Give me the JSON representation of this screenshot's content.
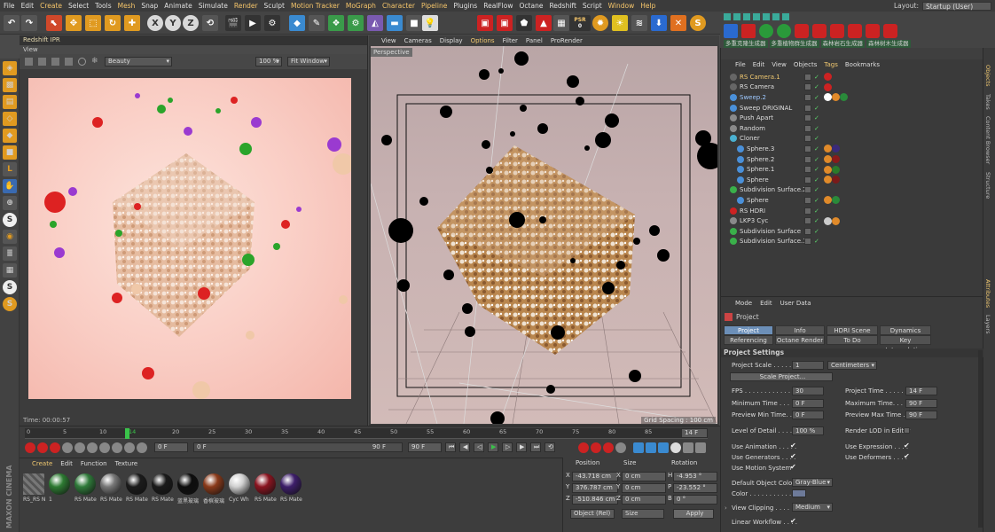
{
  "menu": {
    "items": [
      "File",
      "Edit",
      "Create",
      "Select",
      "Tools",
      "Mesh",
      "Snap",
      "Animate",
      "Simulate",
      "Render",
      "Sculpt",
      "Motion Tracker",
      "MoGraph",
      "Character",
      "Pipeline",
      "Plugins",
      "RealFlow",
      "Octane",
      "Redshift",
      "Script",
      "Window",
      "Help"
    ],
    "layout_label": "Layout:",
    "layout_value": "Startup (User)"
  },
  "toolbar": {
    "coord_x": "X",
    "coord_y": "Y",
    "coord_z": "Z",
    "psr_label": "PSR",
    "psr_value": "0"
  },
  "right_toolbar": {
    "plugin_buttons": [
      "多重克隆生成器",
      "多重植物群生成器",
      "森林岩石生成器",
      "森林树木生成器"
    ]
  },
  "ipr": {
    "title": "Redshift IPR",
    "view_label": "View",
    "aov": "Beauty",
    "zoom": "100 %",
    "fit": "Fit Window",
    "time": "Time: 00:00:57"
  },
  "viewport": {
    "menu": [
      "View",
      "Cameras",
      "Display",
      "Options",
      "Filter",
      "Panel",
      "ProRender"
    ],
    "camera": "Perspective",
    "grid_spacing": "Grid Spacing : 100 cm"
  },
  "timeline": {
    "ticks": [
      "0",
      "5",
      "10",
      "14",
      "20",
      "25",
      "30",
      "35",
      "40",
      "45",
      "50",
      "55",
      "60",
      "65",
      "70",
      "75",
      "80",
      "85",
      "90"
    ],
    "current_frame": "14 F",
    "current_frame_tick": "14",
    "start_field": "0 F",
    "start_field2": "0 F",
    "end_field": "90 F",
    "end_field2": "90 F"
  },
  "materials": {
    "menu": [
      "Create",
      "Edit",
      "Function",
      "Texture"
    ],
    "items": [
      {
        "label": "RS_RS N",
        "color": "#6a6a6a"
      },
      {
        "label": "1",
        "color": "#2d7a32"
      },
      {
        "label": "RS Mate",
        "color": "#2f7a3a"
      },
      {
        "label": "RS Mate",
        "color": "#777777"
      },
      {
        "label": "RS Mate",
        "color": "#1b1b1b"
      },
      {
        "label": "RS Mate",
        "color": "#1a1a1a"
      },
      {
        "label": "蓝黑玻璃",
        "color": "#0d0d0d"
      },
      {
        "label": "香槟玻璃",
        "color": "#8a3a1a"
      },
      {
        "label": "Cyc Wh",
        "color": "#d0d0d0"
      },
      {
        "label": "RS Mate",
        "color": "#8a1420"
      },
      {
        "label": "RS Mate",
        "color": "#3d1e6a"
      }
    ],
    "brand": "MAXON CINEMA 4D"
  },
  "coords": {
    "headers": [
      "Position",
      "Size",
      "Rotation"
    ],
    "rows": [
      {
        "axis": "X",
        "pos": "-43.718 cm",
        "size": "0 cm",
        "rot_axis": "H",
        "rot": "-4.953 °"
      },
      {
        "axis": "Y",
        "pos": "376.787 cm",
        "size": "0 cm",
        "rot_axis": "P",
        "rot": "-23.552 °"
      },
      {
        "axis": "Z",
        "pos": "-510.846 cm",
        "size": "0 cm",
        "rot_axis": "B",
        "rot": "0 °"
      }
    ],
    "mode": "Object (Rel)",
    "size_mode": "Size",
    "apply": "Apply"
  },
  "objects": {
    "menu": [
      "File",
      "Edit",
      "View",
      "Objects",
      "Tags",
      "Bookmarks"
    ],
    "rows": [
      {
        "name": "RS Camera.1",
        "indent": 0,
        "color": "#f0c870",
        "dot": "#666",
        "tags": [
          "#cc2222"
        ]
      },
      {
        "name": "RS Camera",
        "indent": 0,
        "color": "#ddd",
        "dot": "#666",
        "tags": [
          "#cc2222"
        ]
      },
      {
        "name": "Sweep.2",
        "indent": 0,
        "color": "#9ec9ff",
        "dot": "#4a90d9",
        "tags": [
          "#ffffff",
          "#e08a2a",
          "#2a8a3a"
        ]
      },
      {
        "name": "Sweep ORIGINAL",
        "indent": 0,
        "color": "#ddd",
        "dot": "#4a90d9",
        "tags": []
      },
      {
        "name": "Push Apart",
        "indent": 0,
        "color": "#ddd",
        "dot": "#8a8a8a",
        "tags": []
      },
      {
        "name": "Random",
        "indent": 0,
        "color": "#ddd",
        "dot": "#8a8a8a",
        "tags": []
      },
      {
        "name": "Cloner",
        "indent": 0,
        "color": "#ddd",
        "dot": "#4ab0d0",
        "tags": []
      },
      {
        "name": "Sphere.3",
        "indent": 1,
        "color": "#ddd",
        "dot": "#4a90d9",
        "tags": [
          "#e08a2a",
          "#3a2a7a"
        ]
      },
      {
        "name": "Sphere.2",
        "indent": 1,
        "color": "#ddd",
        "dot": "#4a90d9",
        "tags": [
          "#e08a2a",
          "#8a1a1a"
        ]
      },
      {
        "name": "Sphere.1",
        "indent": 1,
        "color": "#ddd",
        "dot": "#4a90d9",
        "tags": [
          "#e08a2a",
          "#2a7a2a"
        ]
      },
      {
        "name": "Sphere",
        "indent": 1,
        "color": "#ddd",
        "dot": "#4a90d9",
        "tags": [
          "#e08a2a",
          "#7a1a1a"
        ]
      },
      {
        "name": "Subdivision Surface.2",
        "indent": 0,
        "color": "#ddd",
        "dot": "#3ab04a",
        "tags": []
      },
      {
        "name": "Sphere",
        "indent": 1,
        "color": "#ddd",
        "dot": "#4a90d9",
        "tags": [
          "#e08a2a",
          "#2a8a3a"
        ]
      },
      {
        "name": "RS HDRI",
        "indent": 0,
        "color": "#ddd",
        "dot": "#cc2222",
        "tags": []
      },
      {
        "name": "LKP3 Cyc",
        "indent": 0,
        "color": "#ddd",
        "dot": "#8a8a8a",
        "tags": [
          "#cccccc",
          "#e08a2a"
        ]
      },
      {
        "name": "Subdivision Surface",
        "indent": 0,
        "color": "#ddd",
        "dot": "#3ab04a",
        "tags": []
      },
      {
        "name": "Subdivision Surface.1",
        "indent": 0,
        "color": "#ddd",
        "dot": "#3ab04a",
        "tags": []
      }
    ]
  },
  "vtabs": [
    "Objects",
    "Takes",
    "Content Browser",
    "Structure"
  ],
  "vtabs2": [
    "Attributes",
    "Layers"
  ],
  "attributes": {
    "menu": [
      "Mode",
      "Edit",
      "User Data"
    ],
    "object": "Project",
    "tabs_row1": [
      "Project Settings",
      "Info",
      "HDRI Scene Hook",
      "Dynamics"
    ],
    "tabs_row2": [
      "Referencing",
      "Octane Render",
      "To Do",
      "Key Interpolation"
    ],
    "section": "Project Settings",
    "project_scale_label": "Project Scale . . . . . .",
    "project_scale": "1",
    "scale_unit": "Centimeters",
    "scale_button": "Scale Project...",
    "fps_label": "FPS . . . . . . . . . . . .",
    "fps": "30",
    "project_time_label": "Project Time . . . . . .",
    "project_time": "14 F",
    "min_time_label": "Minimum Time . . . . .",
    "min_time": "0 F",
    "max_time_label": "Maximum Time. . . . .",
    "max_time": "90 F",
    "prev_min_label": "Preview Min Time. . .",
    "prev_min": "0 F",
    "prev_max_label": "Preview Max Time . .",
    "prev_max": "90 F",
    "lod_label": "Level of Detail . . . . .",
    "lod": "100 %",
    "render_lod_label": "Render LOD in Editor",
    "use_anim_label": "Use Animation . . . . .",
    "use_expr_label": "Use Expression . . . .",
    "use_gen_label": "Use Generators . . . .",
    "use_def_label": "Use Deformers . . . .",
    "use_motion_label": "Use Motion System",
    "default_color_label": "Default Object Color",
    "default_color": "Gray-Blue",
    "color_label": "Color . . . . . . . . . . .",
    "view_clip_label": "View Clipping . . . . .",
    "view_clip": "Medium",
    "linear_label": "Linear Workflow . . . ."
  },
  "colors": {
    "accent": "#f0c870",
    "active_tab": "#6c8fb8",
    "playhead": "#3ac24a"
  }
}
